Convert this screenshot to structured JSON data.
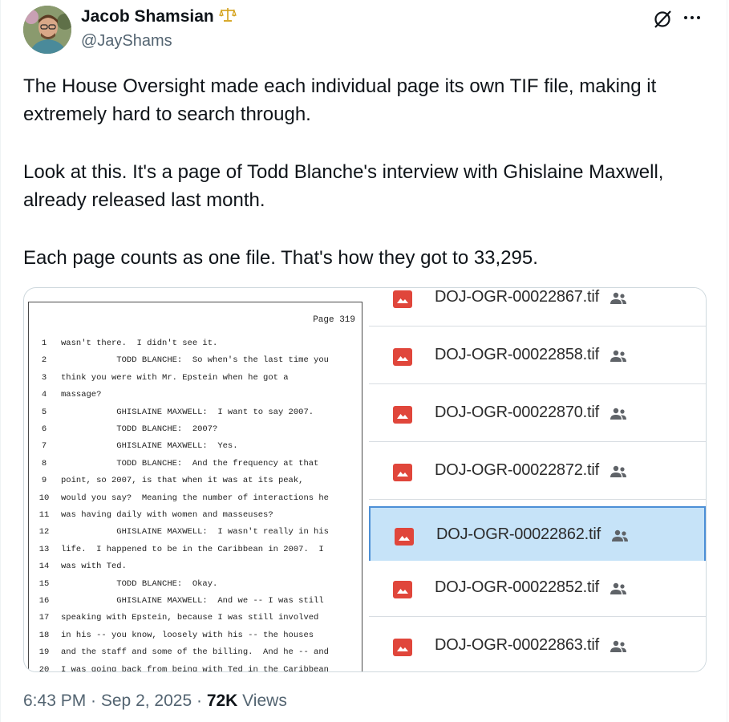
{
  "tweet": {
    "author_name": "Jacob Shamsian",
    "handle": "@JayShams",
    "badge_icon": "scales-icon",
    "paragraphs": [
      "The House Oversight made each individual page its own TIF file, making it extremely hard to search through.",
      "Look at this. It's a page of Todd Blanche's interview with Ghislaine Maxwell, already released last month.",
      "Each  page counts as one file. That's how they got to 33,295."
    ],
    "timestamp": "6:43 PM · Sep 2, 2025",
    "separator": " · ",
    "views_count": "72K",
    "views_label": " Views"
  },
  "document": {
    "page_label": "Page 319",
    "lines": [
      {
        "n": "1",
        "t": "wasn't there.  I didn't see it."
      },
      {
        "n": "2",
        "t": "           TODD BLANCHE:  So when's the last time you"
      },
      {
        "n": "3",
        "t": "think you were with Mr. Epstein when he got a"
      },
      {
        "n": "4",
        "t": "massage?"
      },
      {
        "n": "5",
        "t": "           GHISLAINE MAXWELL:  I want to say 2007."
      },
      {
        "n": "6",
        "t": "           TODD BLANCHE:  2007?"
      },
      {
        "n": "7",
        "t": "           GHISLAINE MAXWELL:  Yes."
      },
      {
        "n": "8",
        "t": "           TODD BLANCHE:  And the frequency at that"
      },
      {
        "n": "9",
        "t": "point, so 2007, is that when it was at its peak,"
      },
      {
        "n": "10",
        "t": "would you say?  Meaning the number of interactions he"
      },
      {
        "n": "11",
        "t": "was having daily with women and masseuses?"
      },
      {
        "n": "12",
        "t": "           GHISLAINE MAXWELL:  I wasn't really in his"
      },
      {
        "n": "13",
        "t": "life.  I happened to be in the Caribbean in 2007.  I"
      },
      {
        "n": "14",
        "t": "was with Ted."
      },
      {
        "n": "15",
        "t": "           TODD BLANCHE:  Okay."
      },
      {
        "n": "16",
        "t": "           GHISLAINE MAXWELL:  And we -- I was still"
      },
      {
        "n": "17",
        "t": "speaking with Epstein, because I was still involved"
      },
      {
        "n": "18",
        "t": "in his -- you know, loosely with his -- the houses"
      },
      {
        "n": "19",
        "t": "and the staff and some of the billing.  And he -- and"
      },
      {
        "n": "20",
        "t": "I was going back from being with Ted in the Caribbean"
      }
    ]
  },
  "files": [
    {
      "name": "DOJ-OGR-00022867.tif",
      "selected": false
    },
    {
      "name": "DOJ-OGR-00022858.tif",
      "selected": false
    },
    {
      "name": "DOJ-OGR-00022870.tif",
      "selected": false
    },
    {
      "name": "DOJ-OGR-00022872.tif",
      "selected": false
    },
    {
      "name": "DOJ-OGR-00022862.tif",
      "selected": true
    },
    {
      "name": "DOJ-OGR-00022852.tif",
      "selected": false
    },
    {
      "name": "DOJ-OGR-00022863.tif",
      "selected": false
    }
  ],
  "icons": {
    "file": "image-file-icon",
    "shared": "shared-people-icon",
    "grok": "grok-icon",
    "more": "more-options-icon"
  },
  "colors": {
    "file_icon": "#e0463b",
    "selected_bg": "#c6e3f8",
    "selected_border": "#4c8fd6",
    "secondary_text": "#536471"
  }
}
